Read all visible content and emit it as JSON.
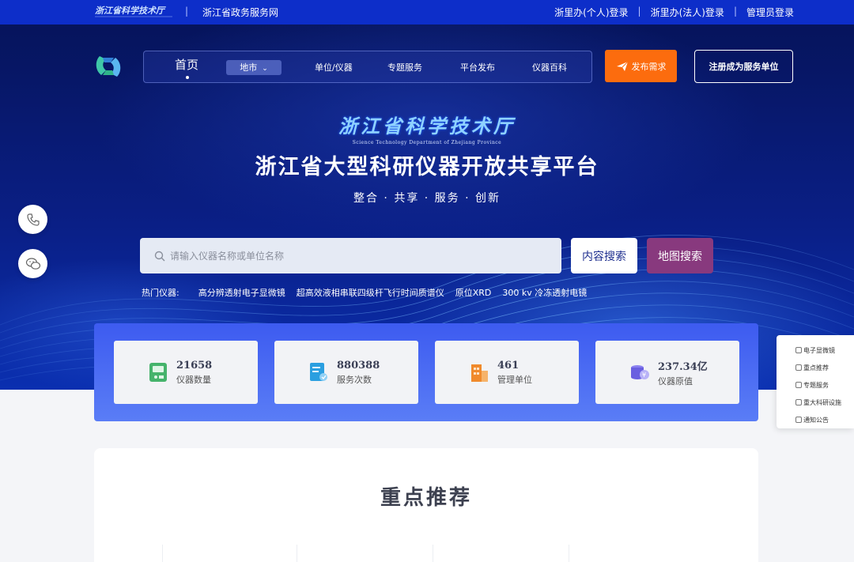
{
  "topbar": {
    "gov_logo_text": "浙江省科学技术厅",
    "govnet": "浙江省政务服务网",
    "login_personal": "浙里办(个人)登录",
    "login_legal": "浙里办(法人)登录",
    "login_admin": "管理员登录"
  },
  "nav": {
    "home": "首页",
    "city": "地市",
    "items": [
      "单位/仪器",
      "专题服务",
      "平台发布",
      "仪器百科"
    ]
  },
  "actions": {
    "publish": "发布需求",
    "register": "注册成为服务单位"
  },
  "hero": {
    "dept_calligraphy": "浙江省科学技术厅",
    "dept_english": "Science Technology Department of Zhejiang Province",
    "title": "浙江省大型科研仪器开放共享平台",
    "slogan": "整合 · 共享 · 服务 · 创新"
  },
  "search": {
    "placeholder": "请输入仪器名称或单位名称",
    "content_btn": "内容搜索",
    "map_btn": "地图搜索"
  },
  "hot": {
    "label": "热门仪器:",
    "items": [
      "高分辨透射电子显微镜",
      "超高效液相串联四级杆飞行时间质谱仪",
      "原位XRD",
      "300 kv 冷冻透射电镜"
    ]
  },
  "stats": [
    {
      "value": "21658",
      "label": "仪器数量",
      "icon": "instrument-icon",
      "color": "#45b36b"
    },
    {
      "value": "880388",
      "label": "服务次数",
      "icon": "service-icon",
      "color": "#2b9fe0"
    },
    {
      "value": "461",
      "label": "管理单位",
      "icon": "building-icon",
      "color": "#f08a2c"
    },
    {
      "value": "237.34亿",
      "label": "仪器原值",
      "icon": "coins-icon",
      "color": "#6a5fe0"
    }
  ],
  "float_menu": [
    "电子显微镜",
    "重点推荐",
    "专题服务",
    "重大科研设施",
    "通知公告"
  ],
  "recommend": {
    "title": "重点推荐"
  },
  "colors": {
    "topbar": "#0d2ec9",
    "publish": "#fc6c0e",
    "map_btn": "#88397e"
  }
}
